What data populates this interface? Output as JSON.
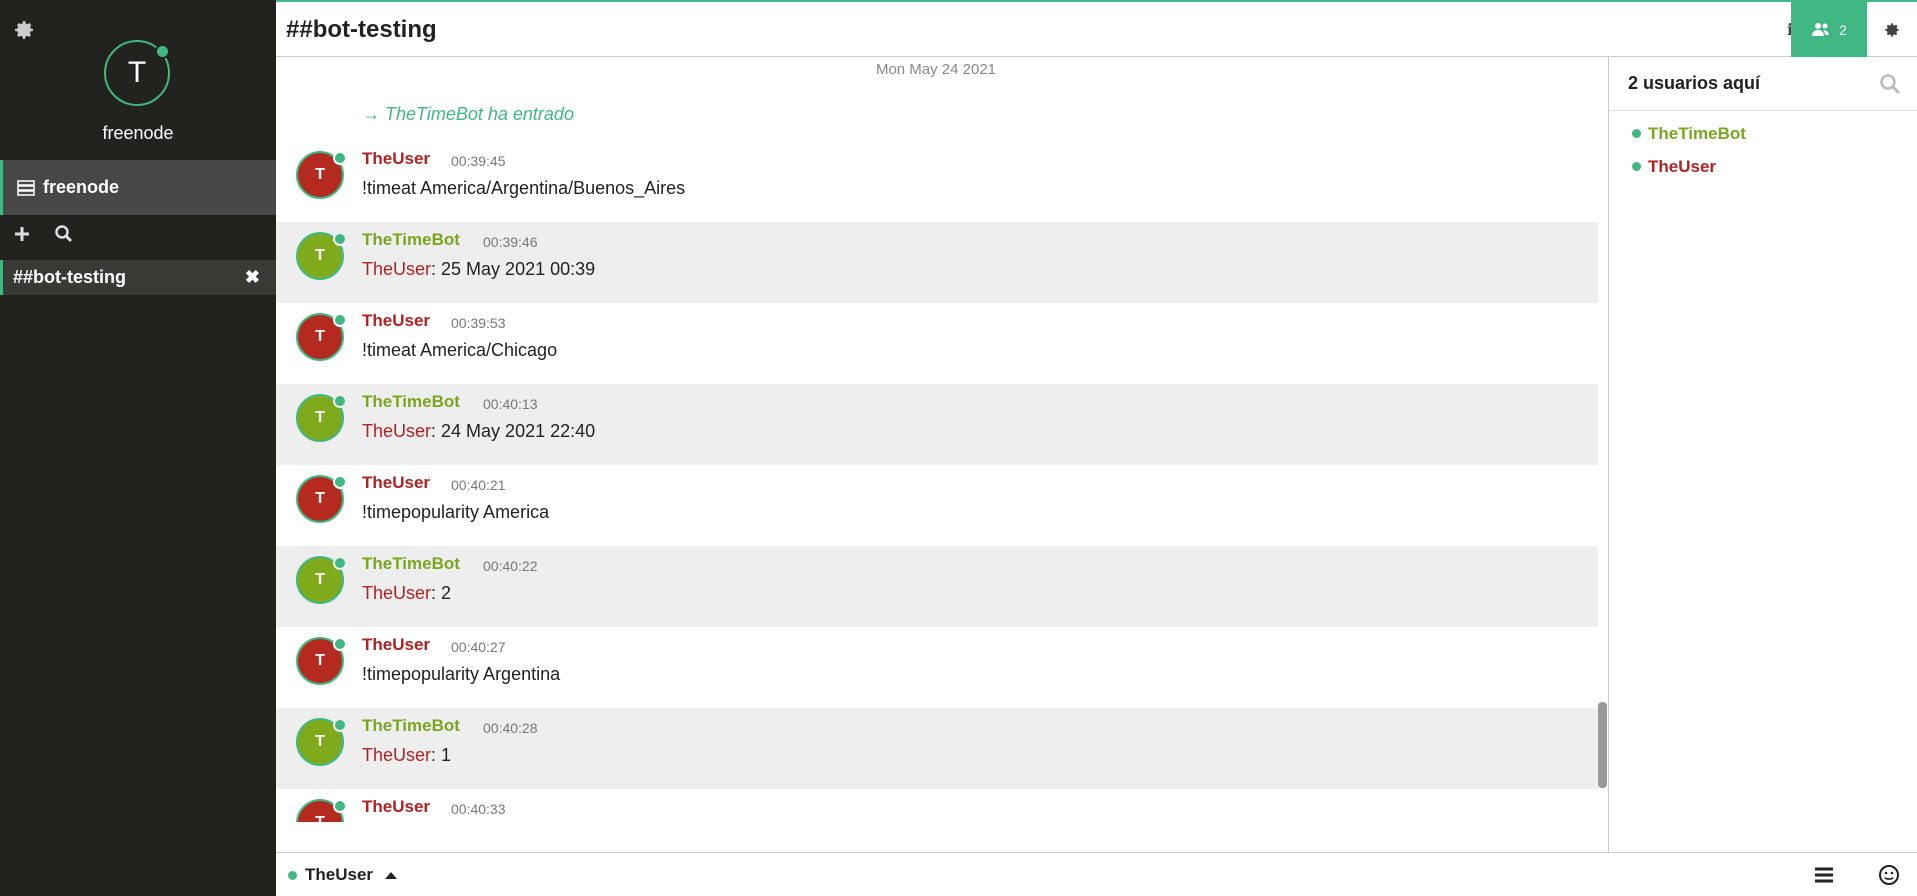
{
  "sidebar": {
    "avatar_initial": "T",
    "network_name": "freenode",
    "network_item_label": "freenode",
    "channel_label": "##bot-testing",
    "close_glyph": "✖"
  },
  "header": {
    "title": "##bot-testing",
    "info_glyph": "i",
    "member_count": "2"
  },
  "messages": {
    "date": "Mon May 24 2021",
    "join_text": "→ TheTimeBot ha entrado",
    "items": [
      {
        "nick": "TheUser",
        "initial": "T",
        "time": "00:39:45",
        "prefix": "",
        "text": "!timeat America/Argentina/Buenos_Aires"
      },
      {
        "nick": "TheTimeBot",
        "initial": "T",
        "time": "00:39:46",
        "prefix": "TheUser",
        "text": ": 25 May 2021 00:39"
      },
      {
        "nick": "TheUser",
        "initial": "T",
        "time": "00:39:53",
        "prefix": "",
        "text": "!timeat America/Chicago"
      },
      {
        "nick": "TheTimeBot",
        "initial": "T",
        "time": "00:40:13",
        "prefix": "TheUser",
        "text": ": 24 May 2021 22:40"
      },
      {
        "nick": "TheUser",
        "initial": "T",
        "time": "00:40:21",
        "prefix": "",
        "text": "!timepopularity America"
      },
      {
        "nick": "TheTimeBot",
        "initial": "T",
        "time": "00:40:22",
        "prefix": "TheUser",
        "text": ": 2"
      },
      {
        "nick": "TheUser",
        "initial": "T",
        "time": "00:40:27",
        "prefix": "",
        "text": "!timepopularity Argentina"
      },
      {
        "nick": "TheTimeBot",
        "initial": "T",
        "time": "00:40:28",
        "prefix": "TheUser",
        "text": ": 1"
      },
      {
        "nick": "TheUser",
        "initial": "T",
        "time": "00:40:33",
        "prefix": "",
        "text": ""
      }
    ]
  },
  "userlist": {
    "count_label": "2 usuarios aquí",
    "users": [
      {
        "nick": "TheTimeBot"
      },
      {
        "nick": "TheUser"
      }
    ]
  },
  "inputbar": {
    "nick": "TheUser"
  },
  "colors": {
    "accent": "#41b883",
    "sidebar_bg": "#22231f",
    "user_red": "#b22222",
    "bot_green": "#7aa61f"
  },
  "icons": [
    "gear-icon",
    "server-icon",
    "plus-icon",
    "search-icon",
    "close-icon",
    "info-icon",
    "users-icon",
    "menu-icon",
    "emoji-icon"
  ]
}
